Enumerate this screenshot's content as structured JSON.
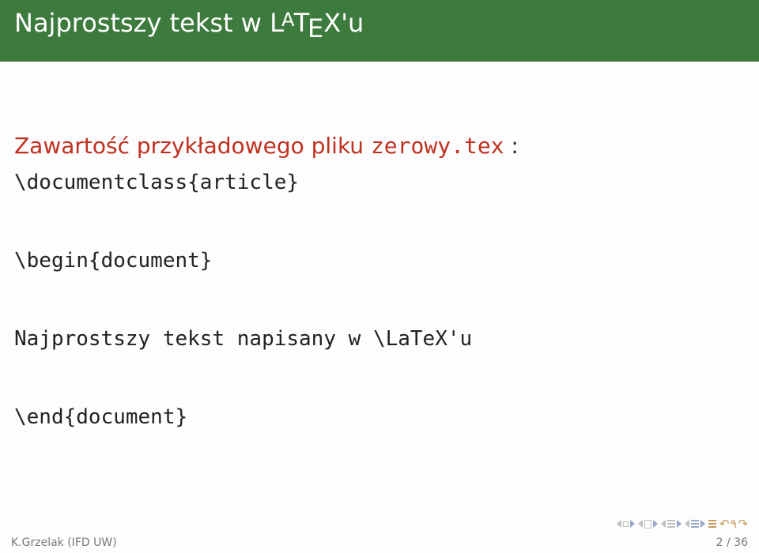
{
  "header": {
    "title_prefix": "Najprostszy tekst w ",
    "title_suffix": "'u"
  },
  "subtitle": {
    "text": "Zawartość przykładowego pliku ",
    "filename": "zerowy.tex",
    "colon": " :"
  },
  "code": {
    "l1": "\\documentclass{article}",
    "l2": "\\begin{document}",
    "l3": "Najprostszy tekst napisany w \\LaTeX'u",
    "l4": "\\end{document}"
  },
  "footer": {
    "author": "K.Grzelak (IFD UW)",
    "page": "2 / 36"
  }
}
